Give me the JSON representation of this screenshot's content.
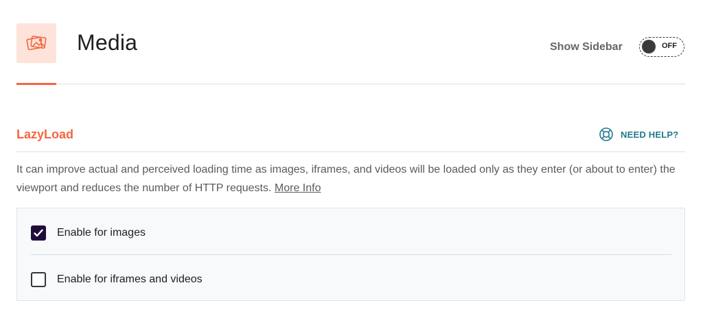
{
  "header": {
    "title": "Media",
    "icon": "media-images-icon",
    "sidebar_toggle": {
      "label": "Show Sidebar",
      "state": "OFF"
    }
  },
  "section": {
    "title": "LazyLoad",
    "help_label": "NEED HELP?",
    "help_icon": "lifebuoy-icon",
    "description": "It can improve actual and perceived loading time as images, iframes, and videos will be loaded only as they enter (or about to enter) the viewport and reduces the number of HTTP requests.",
    "more_info_label": "More Info",
    "options": [
      {
        "label": "Enable for images",
        "checked": true
      },
      {
        "label": "Enable for iframes and videos",
        "checked": false
      }
    ]
  },
  "colors": {
    "accent": "#f56640",
    "accent_bg": "#fde3d9",
    "help": "#1f7a8c",
    "checkbox_checked": "#200c3c"
  }
}
